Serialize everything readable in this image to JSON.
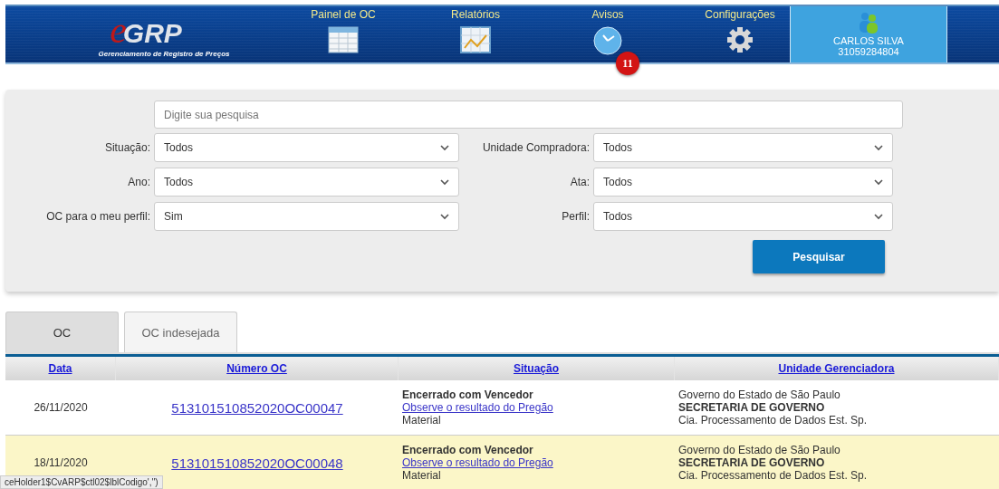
{
  "header": {
    "logo": {
      "mark": "e",
      "name": "GRP",
      "tagline": "Gerenciamento de Registro de Preços"
    },
    "nav": [
      {
        "label": "Painel de OC"
      },
      {
        "label": "Relatórios"
      },
      {
        "label": "Avisos",
        "badge": "11"
      },
      {
        "label": "Configurações"
      }
    ],
    "user": {
      "name": "CARLOS SILVA",
      "id": "31059284804"
    }
  },
  "filters": {
    "search": {
      "placeholder": "Digite sua pesquisa"
    },
    "fields": [
      {
        "label": "Situação:",
        "value": "Todos"
      },
      {
        "label": "Unidade Compradora:",
        "value": "Todos"
      },
      {
        "label": "Ano:",
        "value": "Todos"
      },
      {
        "label": "Ata:",
        "value": "Todos"
      },
      {
        "label": "OC para o meu perfil:",
        "value": "Sim"
      },
      {
        "label": "Perfil:",
        "value": "Todos"
      }
    ],
    "button": "Pesquisar"
  },
  "tabs": [
    {
      "label": "OC",
      "selected": true
    },
    {
      "label": "OC indesejada",
      "selected": false
    }
  ],
  "table": {
    "columns": [
      "Data",
      "Número OC",
      "Situação",
      "Unidade Gerenciadora"
    ],
    "rows": [
      {
        "highlighted": false,
        "date": "26/11/2020",
        "number": "513101510852020OC00047",
        "status": "Encerrado com Vencedor",
        "link": "Observe o resultado do Pregão",
        "type": "Material",
        "gov": "Governo do Estado de São Paulo",
        "secretariat": "SECRETARIA DE GOVERNO",
        "unit": "Cia. Processamento de Dados Est. Sp."
      },
      {
        "highlighted": true,
        "date": "18/11/2020",
        "number": "513101510852020OC00048",
        "status": "Encerrado com Vencedor",
        "link": "Observe o resultado do Pregão",
        "type": "Material",
        "gov": "Governo do Estado de São Paulo",
        "secretariat": "SECRETARIA DE GOVERNO",
        "unit": "Cia. Processamento de Dados Est. Sp."
      }
    ]
  },
  "status_url": "ceHolder1$CvARP$ctl02$lblCodigo','')"
}
